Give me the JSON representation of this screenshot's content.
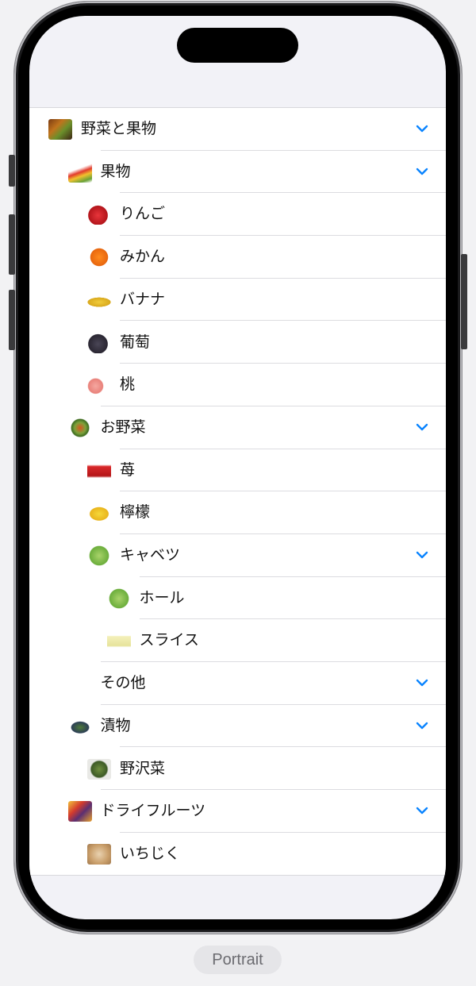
{
  "rows": [
    {
      "label": "野菜と果物",
      "level": 0,
      "icon": "vegetables-fruits-photo",
      "expanded": true
    },
    {
      "label": "果物",
      "level": 1,
      "icon": "fruits-photo",
      "expanded": true
    },
    {
      "label": "りんご",
      "level": 2,
      "icon": "apple-photo",
      "expanded": false
    },
    {
      "label": "みかん",
      "level": 2,
      "icon": "orange-photo",
      "expanded": false
    },
    {
      "label": "バナナ",
      "level": 2,
      "icon": "banana-photo",
      "expanded": false
    },
    {
      "label": "葡萄",
      "level": 2,
      "icon": "grape-photo",
      "expanded": false
    },
    {
      "label": "桃",
      "level": 2,
      "icon": "peach-photo",
      "expanded": false
    },
    {
      "label": "お野菜",
      "level": 1,
      "icon": "vegetables-photo",
      "expanded": true
    },
    {
      "label": "苺",
      "level": 2,
      "icon": "strawberry-photo",
      "expanded": false
    },
    {
      "label": "檸檬",
      "level": 2,
      "icon": "lemon-photo",
      "expanded": false
    },
    {
      "label": "キャベツ",
      "level": 2,
      "icon": "cabbage-photo",
      "expanded": true
    },
    {
      "label": "ホール",
      "level": 3,
      "icon": "cabbage-whole-photo",
      "expanded": false
    },
    {
      "label": "スライス",
      "level": 3,
      "icon": "cabbage-slice-photo",
      "expanded": false
    },
    {
      "label": "その他",
      "level": 1,
      "icon": "",
      "expanded": true
    },
    {
      "label": "漬物",
      "level": 1,
      "icon": "pickles-photo",
      "expanded": true
    },
    {
      "label": "野沢菜",
      "level": 2,
      "icon": "nozawana-photo",
      "expanded": false
    },
    {
      "label": "ドライフルーツ",
      "level": 1,
      "icon": "dried-fruit-photo",
      "expanded": true
    },
    {
      "label": "いちじく",
      "level": 2,
      "icon": "fig-photo",
      "expanded": false
    }
  ],
  "orientation_label": "Portrait",
  "colors": {
    "chevron": "#0a84ff",
    "separator": "#dcdce0",
    "text": "#111111"
  }
}
